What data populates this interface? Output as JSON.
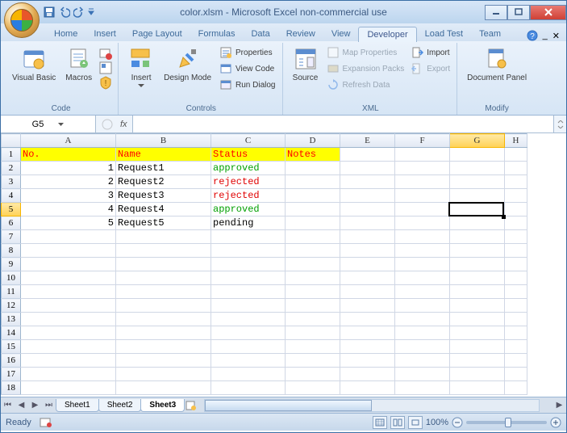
{
  "title": "color.xlsm - Microsoft Excel non-commercial use",
  "tabs": [
    "Home",
    "Insert",
    "Page Layout",
    "Formulas",
    "Data",
    "Review",
    "View",
    "Developer",
    "Load Test",
    "Team"
  ],
  "active_tab": "Developer",
  "ribbon": {
    "code": {
      "label": "Code",
      "visual_basic": "Visual Basic",
      "macros": "Macros"
    },
    "controls": {
      "label": "Controls",
      "insert": "Insert",
      "design_mode": "Design Mode",
      "properties": "Properties",
      "view_code": "View Code",
      "run_dialog": "Run Dialog"
    },
    "xml": {
      "label": "XML",
      "source": "Source",
      "map_properties": "Map Properties",
      "expansion_packs": "Expansion Packs",
      "refresh_data": "Refresh Data",
      "import": "Import",
      "export": "Export"
    },
    "modify": {
      "label": "Modify",
      "document_panel": "Document Panel"
    }
  },
  "namebox": "G5",
  "formula": "",
  "columns": [
    "A",
    "B",
    "C",
    "D",
    "E",
    "F",
    "G",
    "H"
  ],
  "header_row": {
    "A": "No.",
    "B": "Name",
    "C": "Status",
    "D": "Notes"
  },
  "data_rows": [
    {
      "no": "1",
      "name": "Request1",
      "status": "approved",
      "color": "#00a000"
    },
    {
      "no": "2",
      "name": "Request2",
      "status": "rejected",
      "color": "#e00000"
    },
    {
      "no": "3",
      "name": "Request3",
      "status": "rejected",
      "color": "#e00000"
    },
    {
      "no": "4",
      "name": "Request4",
      "status": "approved",
      "color": "#00a000"
    },
    {
      "no": "5",
      "name": "Request5",
      "status": "pending",
      "color": "#000000"
    }
  ],
  "selected_cell": "G5",
  "sheets": [
    "Sheet1",
    "Sheet2",
    "Sheet3"
  ],
  "active_sheet": "Sheet3",
  "status": "Ready",
  "zoom": "100%"
}
